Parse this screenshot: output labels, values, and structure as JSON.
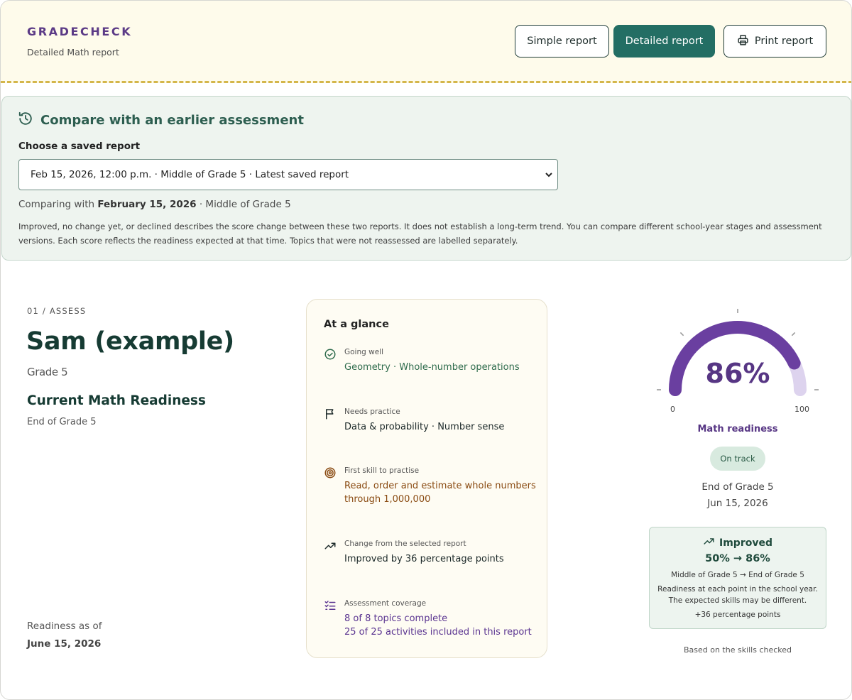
{
  "header": {
    "brand": "GRADECHECK",
    "subtitle": "Detailed Math report",
    "buttons": {
      "simple": "Simple report",
      "detailed": "Detailed report",
      "print": "Print report"
    }
  },
  "compare": {
    "title": "Compare with an earlier assessment",
    "select_label": "Choose a saved report",
    "selected_option": "Feb 15, 2026, 12:00 p.m. · Middle of Grade 5 · Latest saved report",
    "comparing_prefix": "Comparing with ",
    "comparing_date": "February 15, 2026",
    "comparing_suffix": " · Middle of Grade 5",
    "note": "Improved, no change yet, or declined describes the score change between these two reports. It does not establish a long-term trend. You can compare different school-year stages and assessment versions. Each score reflects the readiness expected at that time. Topics that were not reassessed are labelled separately."
  },
  "profile": {
    "step": "01 / ASSESS",
    "student_name": "Sam (example)",
    "grade": "Grade 5",
    "heading": "Current Math Readiness",
    "stage": "End of Grade 5",
    "as_of_label": "Readiness as of",
    "as_of_date": "June 15, 2026"
  },
  "glance": {
    "title": "At a glance",
    "items": [
      {
        "label": "Going well",
        "value": "Geometry · Whole-number operations",
        "icon": "check-circle-icon"
      },
      {
        "label": "Needs practice",
        "value": "Data & probability · Number sense",
        "icon": "flag-icon"
      },
      {
        "label": "First skill to practise",
        "value": "Read, order and estimate whole numbers through 1,000,000",
        "icon": "target-icon"
      },
      {
        "label": "Change from the selected report",
        "value": "Improved by 36 percentage points",
        "icon": "trending-up-icon"
      },
      {
        "label": "Assessment coverage",
        "value": "8 of 8 topics complete",
        "value2": "25 of 25 activities included in this report",
        "icon": "checklist-icon"
      }
    ]
  },
  "gauge": {
    "value": 86,
    "display": "86%",
    "min_label": "0",
    "max_label": "100",
    "label": "Math readiness",
    "status": "On track",
    "stage": "End of Grade 5",
    "date": "Jun 15, 2026",
    "colors": {
      "fill": "#6a3fa0",
      "track": "#ddd3ee"
    }
  },
  "change": {
    "title": "Improved",
    "values": "50% → 86%",
    "stages": "Middle of Grade 5 → End of Grade 5",
    "explain_1": "Readiness at each point in the school year.",
    "explain_2": "The expected skills may be different.",
    "delta": "+36 percentage points"
  },
  "footnote": "Based on the skills checked"
}
